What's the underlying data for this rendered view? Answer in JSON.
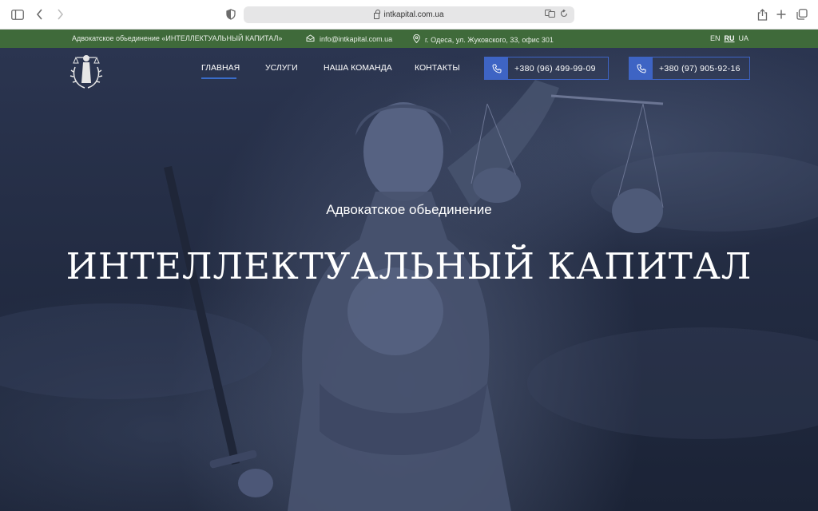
{
  "browser": {
    "url": "intkapital.com.ua"
  },
  "topbar": {
    "org_name": "Адвокатское обьединение «ИНТЕЛЛЕКТУАЛЬНЫЙ КАПИТАЛ»",
    "email": "info@intkapital.com.ua",
    "address": "г. Одеса, ул. Жуковского, 33, офис 301",
    "languages": [
      "EN",
      "RU",
      "UA"
    ],
    "active_language": "RU"
  },
  "nav": {
    "items": [
      "ГЛАВНАЯ",
      "УСЛУГИ",
      "НАША КОМАНДА",
      "КОНТАКТЫ"
    ],
    "active": "ГЛАВНАЯ"
  },
  "phones": [
    "+380 (96) 499-99-09",
    "+380 (97) 905-92-16"
  ],
  "hero": {
    "subtitle": "Адвокатское обьединение",
    "title": "ИНТЕЛЛЕКТУАЛЬНЫЙ КАПИТАЛ"
  },
  "colors": {
    "topbar_bg": "#3f6a3a",
    "accent_blue": "#3e64c4",
    "hero_bg": "#232c43"
  }
}
